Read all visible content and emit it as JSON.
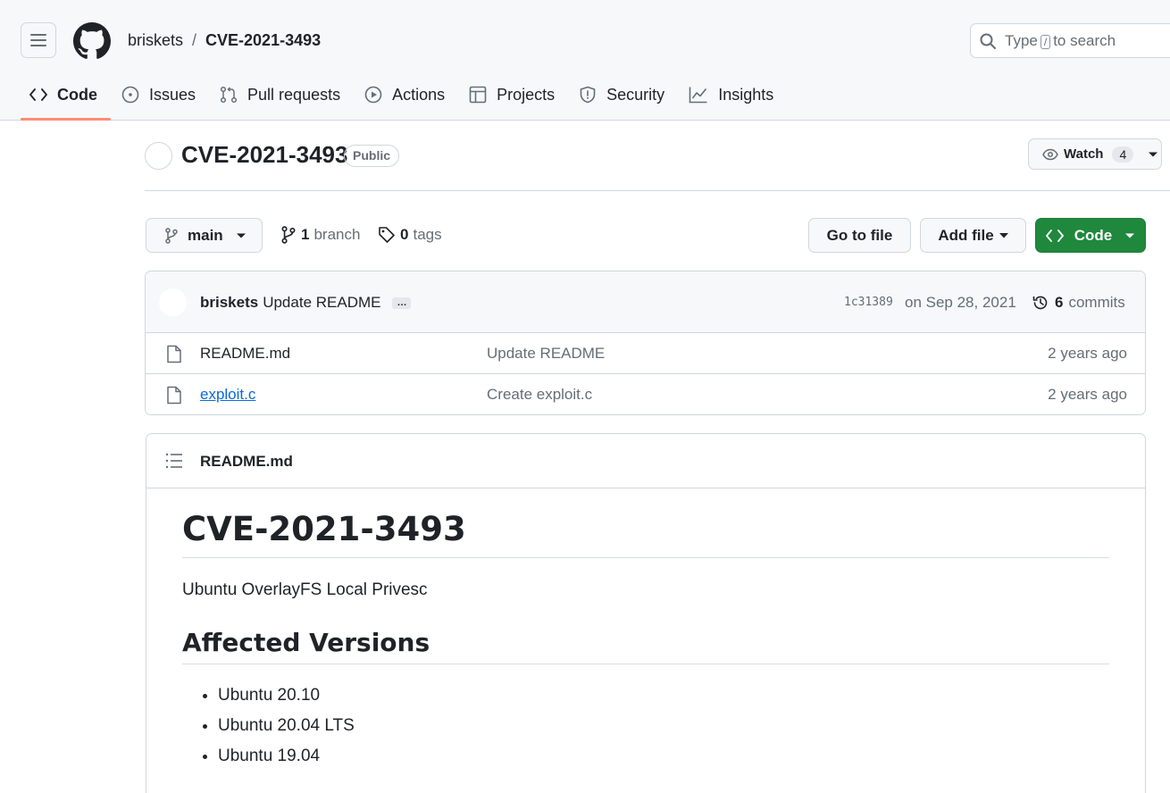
{
  "header": {
    "owner": "briskets",
    "separator": "/",
    "repo": "CVE-2021-3493",
    "search_prefix": "Type",
    "search_key": "/",
    "search_suffix": "to search"
  },
  "tabs": [
    {
      "label": "Code",
      "icon": "code-icon",
      "active": true
    },
    {
      "label": "Issues",
      "icon": "issue-icon"
    },
    {
      "label": "Pull requests",
      "icon": "pull-request-icon"
    },
    {
      "label": "Actions",
      "icon": "play-icon"
    },
    {
      "label": "Projects",
      "icon": "table-icon"
    },
    {
      "label": "Security",
      "icon": "shield-icon"
    },
    {
      "label": "Insights",
      "icon": "graph-icon"
    }
  ],
  "repo": {
    "title": "CVE-2021-3493",
    "visibility": "Public",
    "watch_label": "Watch",
    "watch_count": "4"
  },
  "branch_bar": {
    "branch": "main",
    "branch_count": "1",
    "branch_word": "branch",
    "tag_count": "0",
    "tag_word": "tags",
    "goto_label": "Go to file",
    "addfile_label": "Add file",
    "code_label": "Code"
  },
  "latest_commit": {
    "author": "briskets",
    "message": "Update README",
    "ellipsis": "…",
    "sha": "1c31389",
    "date": "on Sep 28, 2021",
    "commit_count": "6",
    "commit_word": "commits"
  },
  "files": [
    {
      "name": "README.md",
      "commit": "Update README",
      "age": "2 years ago"
    },
    {
      "name": "exploit.c",
      "commit": "Create exploit.c",
      "age": "2 years ago"
    }
  ],
  "readme": {
    "filename": "README.md",
    "h1": "CVE-2021-3493",
    "intro": "Ubuntu OverlayFS Local Privesc",
    "h2": "Affected Versions",
    "versions": [
      "Ubuntu 20.10",
      "Ubuntu 20.04 LTS",
      "Ubuntu 19.04"
    ]
  },
  "colors": {
    "accent": "#fd8c73",
    "code_button": "#1f883d",
    "link": "#0969da"
  }
}
